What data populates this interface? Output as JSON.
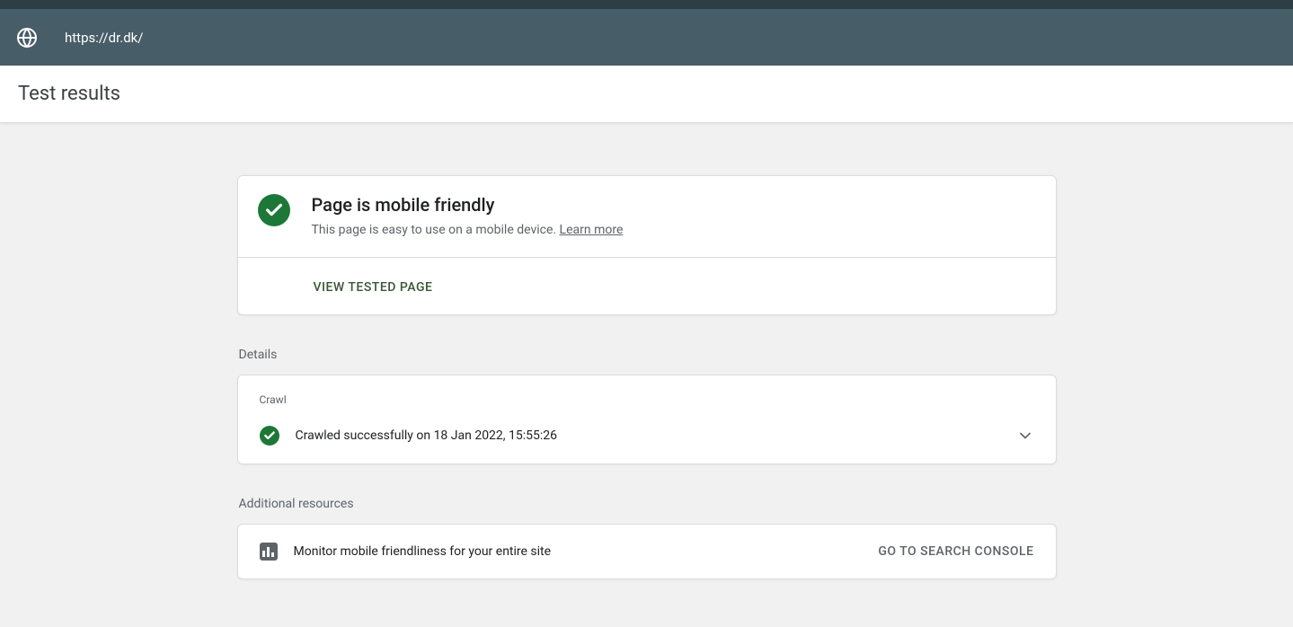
{
  "header": {
    "url": "https://dr.dk/",
    "title": "Test results"
  },
  "result": {
    "heading": "Page is mobile friendly",
    "subtext": "This page is easy to use on a mobile device. ",
    "learn_more": "Learn more",
    "view_tested": "VIEW TESTED PAGE"
  },
  "details": {
    "section_label": "Details",
    "crawl_label": "Crawl",
    "crawl_status": "Crawled successfully on 18 Jan 2022, 15:55:26"
  },
  "resources": {
    "section_label": "Additional resources",
    "monitor_text": "Monitor mobile friendliness for your entire site",
    "console_link": "GO TO SEARCH CONSOLE"
  }
}
